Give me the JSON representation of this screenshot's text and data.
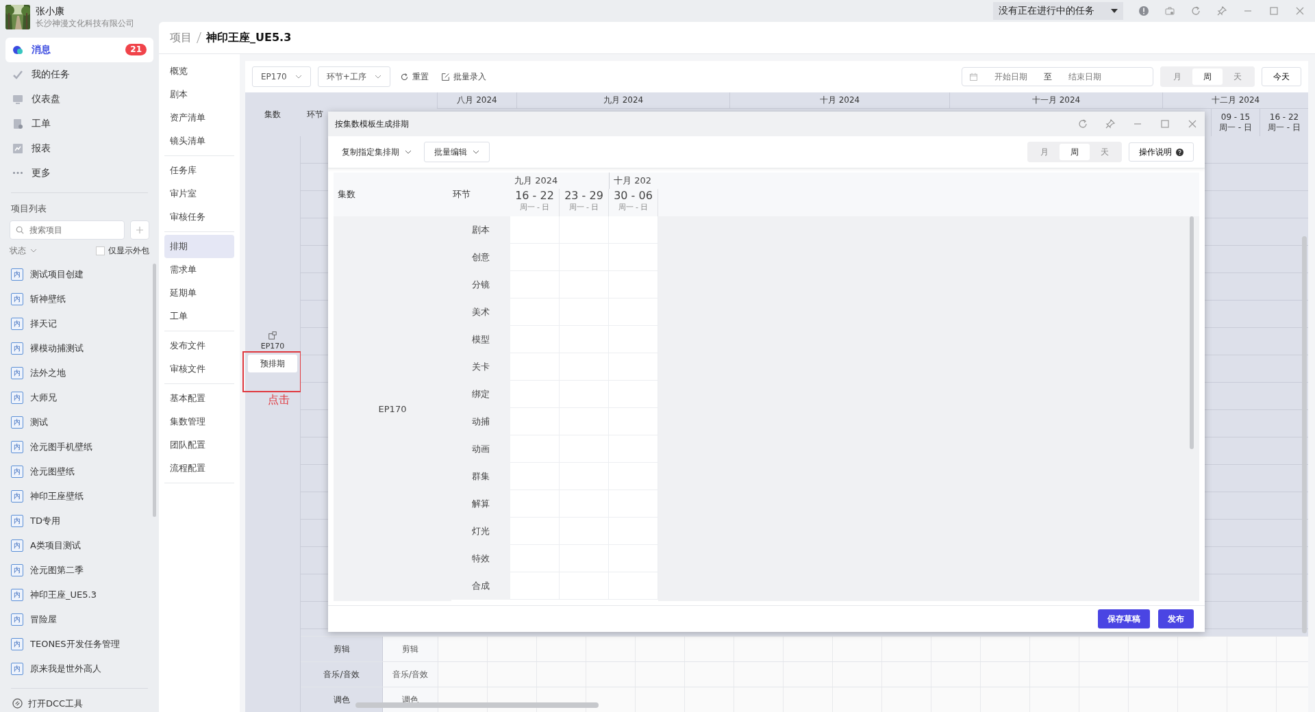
{
  "topbar": {
    "task_menu": "没有正在进行中的任务"
  },
  "sidebar": {
    "user": {
      "name": "张小康",
      "company": "长沙神漫文化科技有限公司"
    },
    "nav": [
      {
        "label": "消息",
        "selected": true,
        "badge": "21"
      },
      {
        "label": "我的任务",
        "selected": false
      },
      {
        "label": "仪表盘",
        "selected": false
      },
      {
        "label": "工单",
        "selected": false
      },
      {
        "label": "报表",
        "selected": false
      },
      {
        "label": "更多",
        "selected": false
      }
    ],
    "projects_title": "项目列表",
    "search": {
      "placeholder": "搜索项目"
    },
    "status_filter": "状态",
    "outsource_only": {
      "label": "仅显示外包",
      "checked": false
    },
    "projects": [
      {
        "tag": "内",
        "name": "测试项目创建"
      },
      {
        "tag": "内",
        "name": "斩神壁纸"
      },
      {
        "tag": "内",
        "name": "择天记"
      },
      {
        "tag": "内",
        "name": "裸模动捕测试"
      },
      {
        "tag": "内",
        "name": "法外之地"
      },
      {
        "tag": "内",
        "name": "大师兄"
      },
      {
        "tag": "内",
        "name": "测试"
      },
      {
        "tag": "内",
        "name": "沧元图手机壁纸"
      },
      {
        "tag": "内",
        "name": "沧元图壁纸"
      },
      {
        "tag": "内",
        "name": "神印王座壁纸"
      },
      {
        "tag": "内",
        "name": "TD专用"
      },
      {
        "tag": "内",
        "name": "A类项目测试"
      },
      {
        "tag": "内",
        "name": "沧元图第二季"
      },
      {
        "tag": "内",
        "name": "神印王座_UE5.3"
      },
      {
        "tag": "内",
        "name": "冒险屋"
      },
      {
        "tag": "内",
        "name": "TEONES开发任务管理"
      },
      {
        "tag": "内",
        "name": "原来我是世外高人"
      }
    ],
    "footer_link": "打开DCC工具"
  },
  "breadcrumb": {
    "parent": "项目",
    "current": "神印王座_UE5.3"
  },
  "subnav": [
    [
      {
        "label": "概览",
        "selected": false
      },
      {
        "label": "剧本",
        "selected": false
      },
      {
        "label": "资产清单",
        "selected": false
      },
      {
        "label": "镜头清单",
        "selected": false
      }
    ],
    [
      {
        "label": "任务库",
        "selected": false
      },
      {
        "label": "审片室",
        "selected": false
      },
      {
        "label": "审核任务",
        "selected": false
      }
    ],
    [
      {
        "label": "排期",
        "selected": true
      },
      {
        "label": "需求单",
        "selected": false
      },
      {
        "label": "延期单",
        "selected": false
      },
      {
        "label": "工单",
        "selected": false
      }
    ],
    [
      {
        "label": "发布文件",
        "selected": false
      },
      {
        "label": "审核文件",
        "selected": false
      }
    ],
    [
      {
        "label": "基本配置",
        "selected": false
      },
      {
        "label": "集数管理",
        "selected": false
      },
      {
        "label": "团队配置",
        "selected": false
      },
      {
        "label": "流程配置",
        "selected": false
      }
    ]
  ],
  "toolbar": {
    "episode_select": "EP170",
    "mode_select": "环节+工序",
    "reset": "重置",
    "batch_entry": "批量录入",
    "date_range": {
      "start_placeholder": "开始日期",
      "separator": "至",
      "end_placeholder": "结束日期"
    },
    "view": [
      {
        "label": "月",
        "selected": false
      },
      {
        "label": "周",
        "selected": true
      },
      {
        "label": "天",
        "selected": false
      }
    ],
    "today": "今天"
  },
  "schedule": {
    "columns": [
      "集数",
      "环节"
    ],
    "months": [
      "八月 2024",
      "九月 2024",
      "十月 2024",
      "十一月 2024",
      "十二月 2024"
    ],
    "weeks": [
      {
        "range": "09 - 15",
        "days": "周一 - 日"
      },
      {
        "range": "16 - 22",
        "days": "周一 - 日"
      }
    ],
    "episode": {
      "name": "EP170",
      "action": "预排期"
    },
    "rows": [
      {
        "stage": "剪辑",
        "process": "剪辑"
      },
      {
        "stage": "音乐/音效",
        "process": "音乐/音效"
      },
      {
        "stage": "调色",
        "process": "调色"
      }
    ]
  },
  "annotation": {
    "text": "点击"
  },
  "dialog": {
    "title": "按集数模板生成排期",
    "copy_menu": "复制指定集排期",
    "batch_edit": "批量编辑",
    "view": [
      {
        "label": "月",
        "selected": false
      },
      {
        "label": "周",
        "selected": true
      },
      {
        "label": "天",
        "selected": false
      }
    ],
    "help": "操作说明",
    "columns": [
      "集数",
      "环节"
    ],
    "months": [
      "九月 2024",
      "十月 202"
    ],
    "weeks": [
      {
        "range": "16 - 22",
        "days": "周一 - 日"
      },
      {
        "range": "23 - 29",
        "days": "周一 - 日"
      },
      {
        "range": "30 - 06",
        "days": "周一 - 日"
      }
    ],
    "episode": "EP170",
    "stages": [
      "剧本",
      "创意",
      "分镜",
      "美术",
      "模型",
      "关卡",
      "绑定",
      "动捕",
      "动画",
      "群集",
      "解算",
      "灯光",
      "特效",
      "合成"
    ],
    "save_draft": "保存草稿",
    "publish": "发布"
  }
}
